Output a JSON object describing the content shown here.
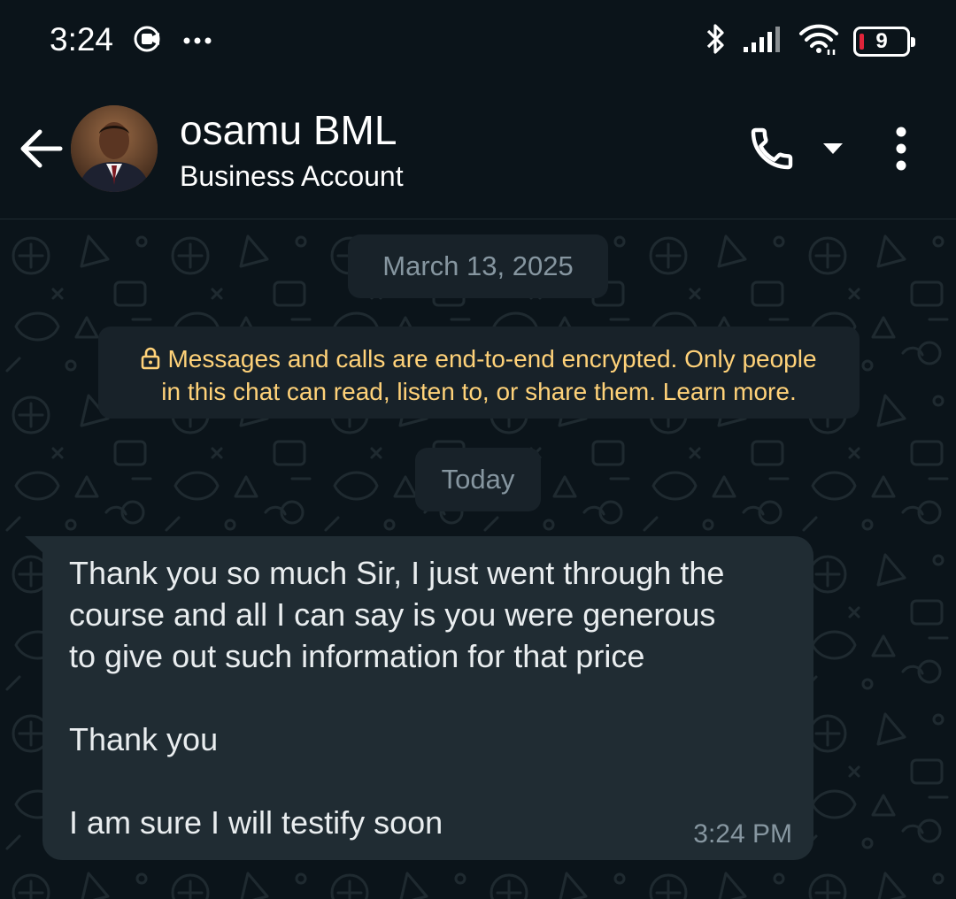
{
  "status_bar": {
    "time": "3:24",
    "left_icons": [
      "screen-record-icon",
      "more-dots-icon"
    ],
    "right_icons": [
      "bluetooth-icon",
      "signal-icon",
      "wifi-icon",
      "battery-icon"
    ],
    "battery_level": "9",
    "battery_color": "#e0243a"
  },
  "header": {
    "contact_name": "osamu BML",
    "subtitle": "Business Account",
    "icons": [
      "back-arrow-icon",
      "avatar",
      "phone-icon",
      "chevron-down-icon",
      "more-vertical-icon"
    ]
  },
  "chat": {
    "date_chips": [
      "March 13, 2025",
      "Today"
    ],
    "encryption_notice": {
      "line1": "Messages and calls are end-to-end encrypted. Only people",
      "line2": "in this chat can read, listen to, or share them. Learn more.",
      "icon": "lock-icon",
      "color": "#ffd279"
    },
    "messages": [
      {
        "direction": "incoming",
        "lines": [
          "Thank you so much Sir, I just went through the",
          "course and all I can say is you were generous",
          "to give out such information for that price",
          "",
          "Thank you",
          "",
          "I am sure I will testify soon"
        ],
        "time": "3:24 PM"
      }
    ]
  },
  "colors": {
    "background": "#0b141a",
    "bubble": "#202c33",
    "chip": "#182229",
    "secondary_text": "#8696a0"
  }
}
